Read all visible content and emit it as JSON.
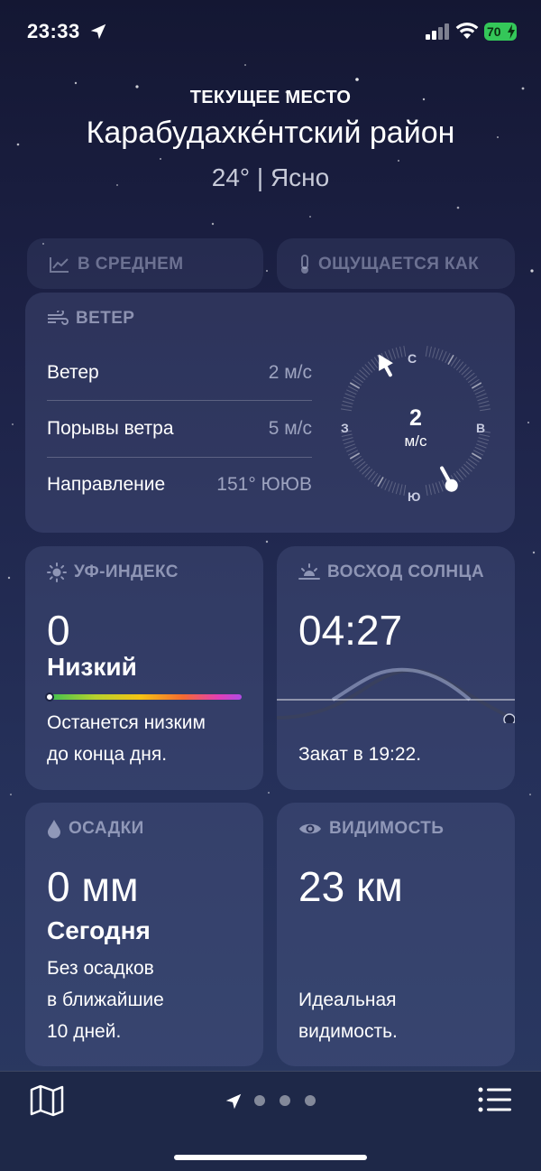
{
  "status_bar": {
    "time": "23:33",
    "battery_percent": "70",
    "location_icon": "location-arrow-icon",
    "signal_icon": "cellular-signal-icon",
    "wifi_icon": "wifi-icon"
  },
  "header": {
    "place_label": "ТЕКУЩЕЕ МЕСТО",
    "place_name": "Карабудахке́нтский район",
    "summary": "24° | Ясно"
  },
  "pills": [
    {
      "label": "В СРЕДНЕМ",
      "icon": "trend-chart-icon"
    },
    {
      "label": "ОЩУЩАЕТСЯ КАК",
      "icon": "thermometer-icon"
    }
  ],
  "wind": {
    "title": "ВЕТЕР",
    "icon": "wind-icon",
    "rows": [
      {
        "label": "Ветер",
        "value": "2 м/с"
      },
      {
        "label": "Порывы ветра",
        "value": "5 м/с"
      },
      {
        "label": "Направление",
        "value": "151° ЮЮВ"
      }
    ],
    "compass": {
      "speed": "2",
      "unit": "м/с",
      "north": "С",
      "east": "В",
      "south": "Ю",
      "west": "З",
      "direction_degrees": 151
    }
  },
  "uv": {
    "title": "УФ-ИНДЕКС",
    "icon": "sun-icon",
    "value": "0",
    "level": "Низкий",
    "description_line1": "Останется низким",
    "description_line2": "до конца дня.",
    "index_fraction": 0
  },
  "sunrise": {
    "title": "ВОСХОД СОЛНЦА",
    "icon": "sunrise-icon",
    "time": "04:27",
    "sunset": "Закат в 19:22."
  },
  "precip": {
    "title": "ОСАДКИ",
    "icon": "raindrop-icon",
    "value": "0 мм",
    "period": "Сегодня",
    "line1": "Без осадков",
    "line2": "в ближайшие",
    "line3": "10 дней."
  },
  "visibility": {
    "title": "ВИДИМОСТЬ",
    "icon": "eye-icon",
    "value": "23 км",
    "line1": "Идеальная",
    "line2": "видимость."
  },
  "bottom_bar": {
    "map_icon": "map-icon",
    "location_icon": "location-arrow-icon",
    "list_icon": "list-icon",
    "page_dots": 3
  },
  "colors": {
    "background_top": "#141733",
    "background_bottom": "#2b3a63",
    "battery": "#34c759"
  }
}
